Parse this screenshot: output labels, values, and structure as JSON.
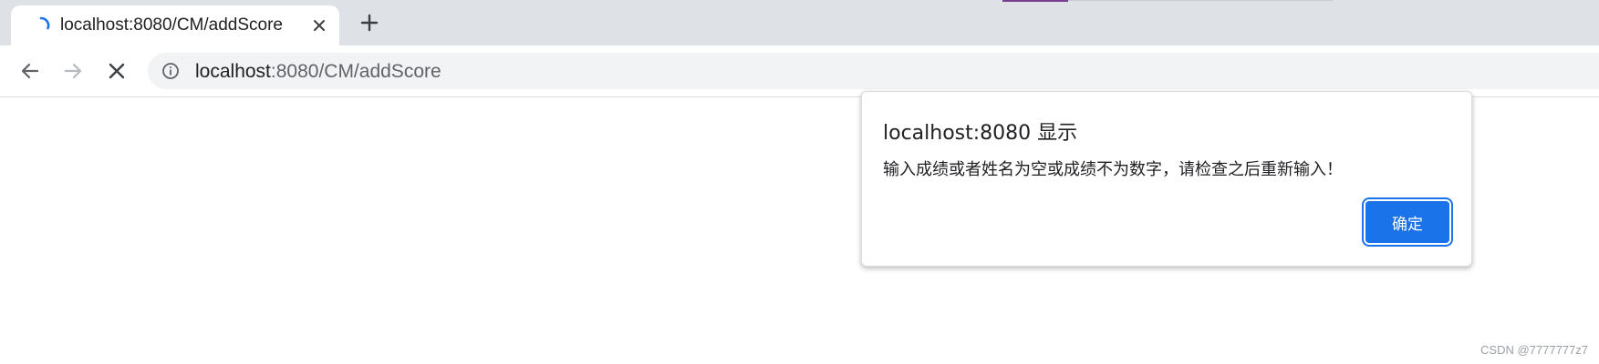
{
  "tab": {
    "title": "localhost:8080/CM/addScore",
    "loading": true
  },
  "toolbar": {
    "url_host": "localhost",
    "url_rest": ":8080/CM/addScore"
  },
  "dialog": {
    "title": "localhost:8080 显示",
    "message": "输入成绩或者姓名为空或成绩不为数字，请检查之后重新输入！",
    "ok_label": "确定"
  },
  "watermark": "CSDN @7777777z7",
  "colors": {
    "tabstrip_bg": "#dee1e6",
    "accent": "#1a73e8",
    "spinner": "#1a73e8"
  },
  "icons": {
    "spinner": "loading-spinner-icon",
    "tab_close": "close-icon",
    "new_tab": "plus-icon",
    "back": "arrow-left-icon",
    "forward": "arrow-right-icon",
    "stop": "stop-x-icon",
    "site_info": "info-icon"
  }
}
